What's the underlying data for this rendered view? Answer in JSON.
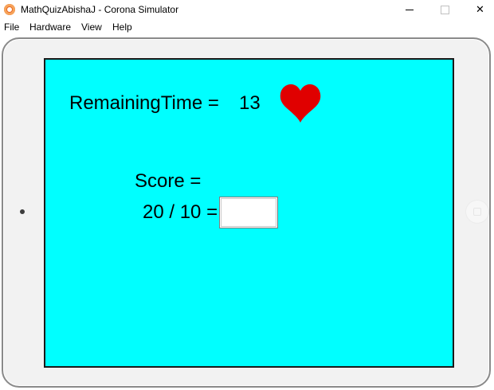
{
  "window": {
    "title": "MathQuizAbishaJ - Corona Simulator",
    "minimize_glyph": "",
    "close_glyph": "✕"
  },
  "menu": {
    "items": [
      {
        "label": "File"
      },
      {
        "label": "Hardware"
      },
      {
        "label": "View"
      },
      {
        "label": "Help"
      }
    ]
  },
  "game": {
    "remaining_label": "RemainingTime =",
    "remaining_value": "13",
    "score_label": "Score =",
    "question": "20 / 10 =",
    "answer_value": "",
    "heart_color": "#e00000",
    "screen_color": "#00ffff"
  }
}
